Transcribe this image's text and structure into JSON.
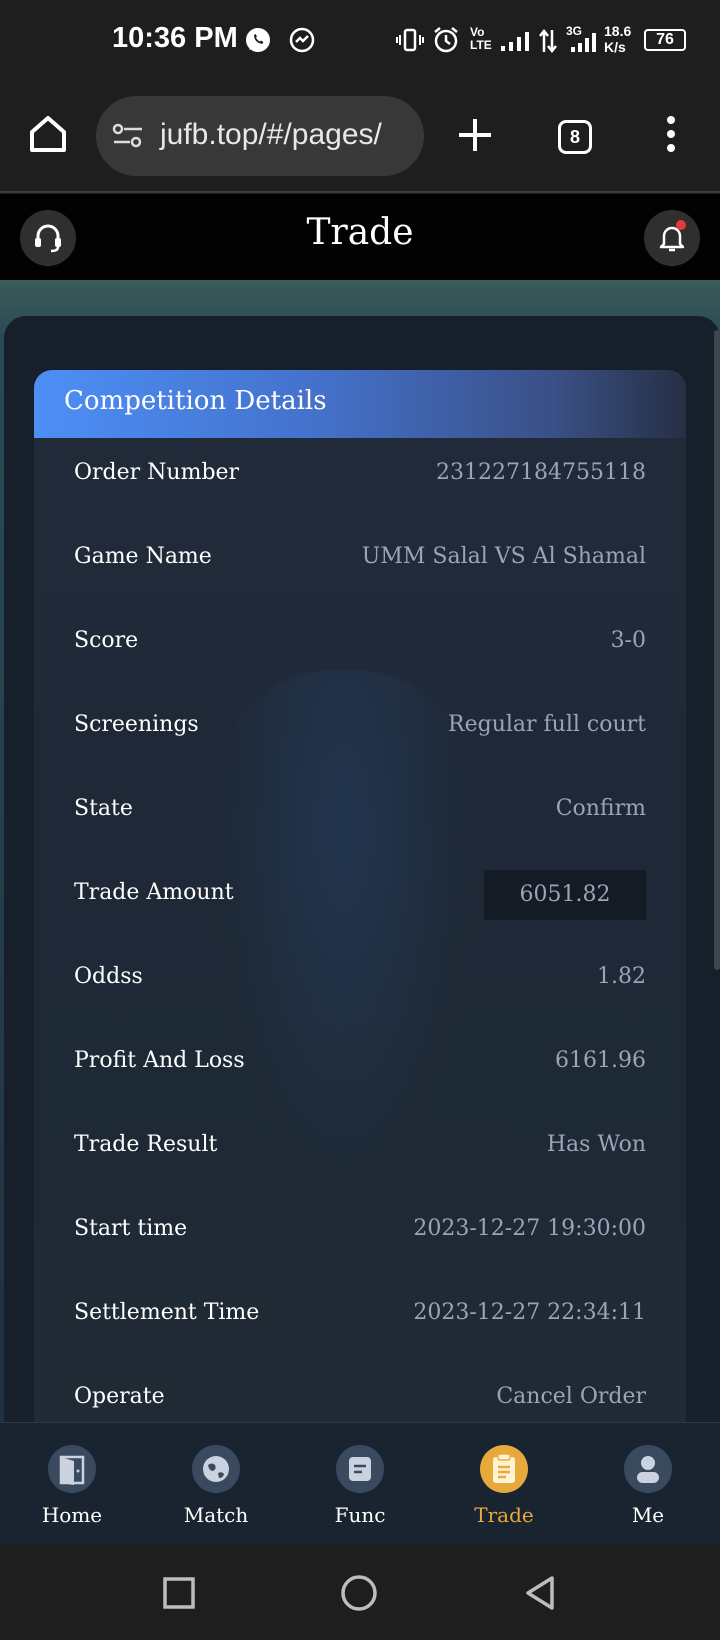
{
  "status_bar": {
    "time": "10:36 PM",
    "network_type": "3G",
    "network_label": "Vo LTE",
    "speed": "18.6",
    "speed_unit": "K/s",
    "battery": "76"
  },
  "browser": {
    "url": "jufb.top/#/pages/",
    "tab_count": "8"
  },
  "header": {
    "title": "Trade"
  },
  "card": {
    "title": "Competition Details",
    "rows": [
      {
        "label": "Order Number",
        "value": "231227184755118"
      },
      {
        "label": "Game Name",
        "value": "UMM Salal VS Al Shamal"
      },
      {
        "label": "Score",
        "value": "3-0"
      },
      {
        "label": "Screenings",
        "value": "Regular full court"
      },
      {
        "label": "State",
        "value": "Confirm"
      },
      {
        "label": "Trade Amount",
        "value": "6051.82"
      },
      {
        "label": "Oddss",
        "value": "1.82"
      },
      {
        "label": "Profit And Loss",
        "value": "6161.96"
      },
      {
        "label": "Trade Result",
        "value": "Has Won"
      },
      {
        "label": "Start time",
        "value": "2023-12-27 19:30:00"
      },
      {
        "label": "Settlement Time",
        "value": "2023-12-27 22:34:11"
      },
      {
        "label": "Operate",
        "value": "Cancel Order"
      }
    ]
  },
  "bottom_nav": {
    "items": [
      {
        "label": "Home",
        "icon": "home-door-icon"
      },
      {
        "label": "Match",
        "icon": "globe-icon"
      },
      {
        "label": "Func",
        "icon": "document-icon"
      },
      {
        "label": "Trade",
        "icon": "clipboard-icon",
        "active": true
      },
      {
        "label": "Me",
        "icon": "user-icon"
      }
    ],
    "active_color": "#e8a93b"
  },
  "colors": {
    "accent_blue": "#4d8ff7",
    "value_text": "#9aa4b8",
    "notification": "#e23b3b"
  }
}
